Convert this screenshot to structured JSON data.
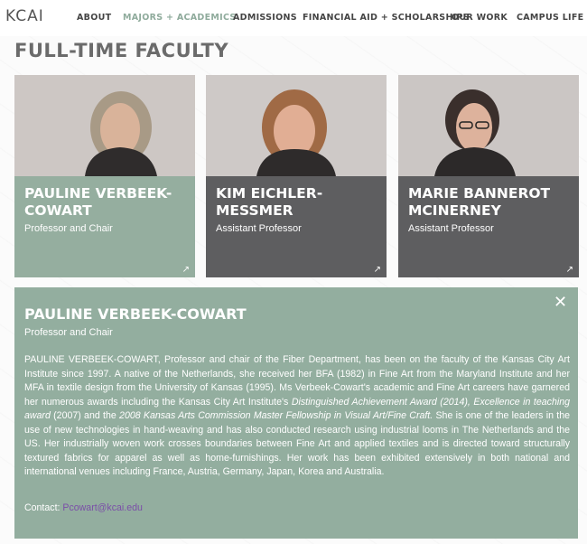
{
  "header": {
    "logo": "KCAI",
    "nav": [
      {
        "label": "ABOUT"
      },
      {
        "label": "MAJORS + ACADEMICS",
        "active": true
      },
      {
        "label": "ADMISSIONS"
      },
      {
        "label": "FINANCIAL AID + SCHOLARSHIPS"
      },
      {
        "label": "OUR WORK"
      },
      {
        "label": "CAMPUS LIFE"
      }
    ]
  },
  "page": {
    "title": "FULL-TIME FACULTY"
  },
  "faculty": [
    {
      "name": "PAULINE VERBEEK-COWART",
      "role": "Professor and Chair",
      "card_color": "#95ae9f",
      "arrow": "↗"
    },
    {
      "name": "KIM EICHLER-MESSMER",
      "role": "Assistant Professor",
      "card_color": "#5e5e60",
      "arrow": "↗"
    },
    {
      "name": "MARIE BANNEROT MCINERNEY",
      "role": "Assistant Professor",
      "card_color": "#5e5e60",
      "arrow": "↗"
    }
  ],
  "detail": {
    "name": "PAULINE VERBEEK-COWART",
    "role": "Professor and Chair",
    "close": "✕",
    "bio_parts": [
      "PAULINE VERBEEK-COWART, Professor and chair of the Fiber Department, has been on the faculty of the Kansas City Art Institute since 1997. A native of the Netherlands, she received her BFA (1982) in Fine Art from the Maryland Institute and her MFA in textile design from the University of Kansas (1995). Ms Verbeek-Cowart's academic and Fine Art careers have garnered her numerous awards including the Kansas City Art Institute's ",
      "Distinguished Achievement Award (2014), Excellence in teaching award",
      " (2007) and the ",
      "2008 Kansas Arts Commission Master Fellowship in Visual Art/Fine Craft.",
      " She is one of the leaders in the use of new technologies in hand-weaving and has also conducted research using industrial looms in The Netherlands and the US. Her industrially woven work crosses boundaries between Fine Art and applied textiles and is directed toward structurally textured fabrics for apparel as well as home-furnishings. Her work has been exhibited extensively in both national and international venues including France, Austria, Germany, Japan, Korea and Australia."
    ],
    "contact_label": "Contact:",
    "contact_email": "Pcowart@kcai.edu"
  },
  "colors": {
    "accent_green": "#93ae9f",
    "card_gray": "#5e5e60",
    "email_link": "#7b4ea8"
  }
}
